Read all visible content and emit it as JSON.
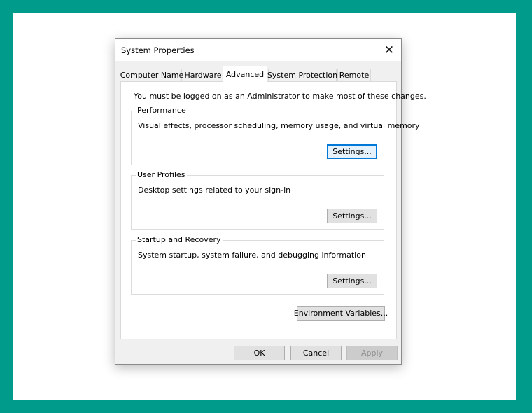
{
  "dialog": {
    "title": "System Properties",
    "close_glyph": "✕"
  },
  "tabs": [
    {
      "label": "Computer Name",
      "active": false
    },
    {
      "label": "Hardware",
      "active": false
    },
    {
      "label": "Advanced",
      "active": true
    },
    {
      "label": "System Protection",
      "active": false
    },
    {
      "label": "Remote",
      "active": false
    }
  ],
  "advanced": {
    "admin_note": "You must be logged on as an Administrator to make most of these changes.",
    "performance": {
      "legend": "Performance",
      "description": "Visual effects, processor scheduling, memory usage, and virtual memory",
      "button": "Settings..."
    },
    "user_profiles": {
      "legend": "User Profiles",
      "description": "Desktop settings related to your sign-in",
      "button": "Settings..."
    },
    "startup_recovery": {
      "legend": "Startup and Recovery",
      "description": "System startup, system failure, and debugging information",
      "button": "Settings..."
    },
    "env_vars_button": "Environment Variables..."
  },
  "footer": {
    "ok": "OK",
    "cancel": "Cancel",
    "apply": "Apply"
  },
  "colors": {
    "background": "#009b8a",
    "focus_accent": "#0078d7"
  }
}
